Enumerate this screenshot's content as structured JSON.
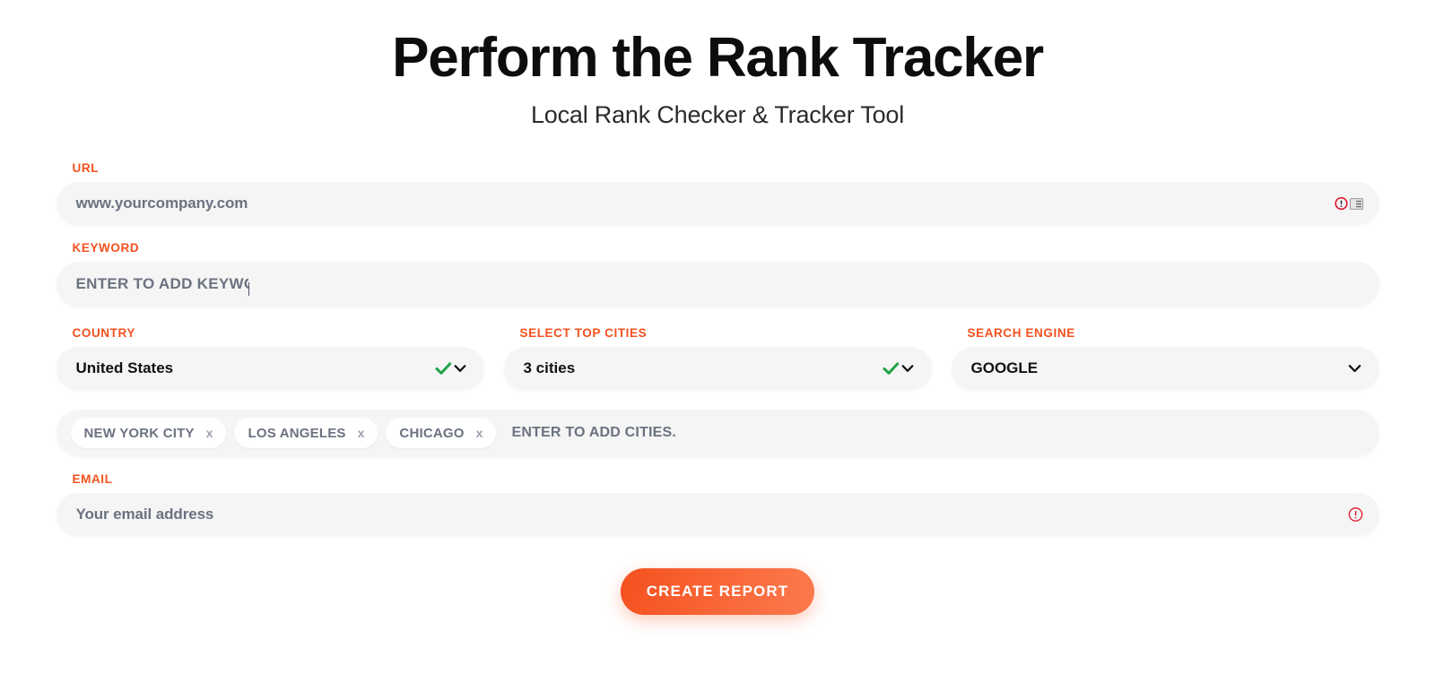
{
  "header": {
    "title": "Perform the Rank Tracker",
    "subtitle": "Local Rank Checker & Tracker Tool"
  },
  "colors": {
    "accent": "#F4511E",
    "field_bg": "#F5F5F5",
    "text_dark": "#111111",
    "text_muted": "#6B7280",
    "check_green": "#22A44B",
    "error_red": "#E11931"
  },
  "form": {
    "url": {
      "label": "URL",
      "placeholder": "www.yourcompany.com",
      "value": "",
      "error_icon": "error-circle-icon",
      "list_icon": "autofill-list-icon"
    },
    "keyword": {
      "label": "KEYWORD",
      "placeholder": "ENTER TO ADD KEYWORD",
      "value": ""
    },
    "country": {
      "label": "COUNTRY",
      "value": "United States",
      "options": [
        "United States"
      ],
      "check_icon": "green-check-icon",
      "chevron_icon": "chevron-down-icon"
    },
    "top_cities": {
      "label": "SELECT TOP CITIES",
      "value": "3 cities",
      "options": [
        "3 cities"
      ],
      "check_icon": "green-check-icon",
      "chevron_icon": "chevron-down-icon"
    },
    "search_engine": {
      "label": "SEARCH ENGINE",
      "value": "GOOGLE",
      "options": [
        "GOOGLE"
      ],
      "chevron_icon": "chevron-down-icon"
    },
    "cities": {
      "tags": [
        {
          "label": "NEW YORK CITY",
          "remove": "x"
        },
        {
          "label": "LOS ANGELES",
          "remove": "x"
        },
        {
          "label": "CHICAGO",
          "remove": "x"
        }
      ],
      "placeholder": "ENTER TO ADD CITIES."
    },
    "email": {
      "label": "EMAIL",
      "placeholder": "Your email address",
      "value": "",
      "error_icon": "error-circle-icon"
    },
    "submit": {
      "label": "CREATE REPORT"
    }
  }
}
